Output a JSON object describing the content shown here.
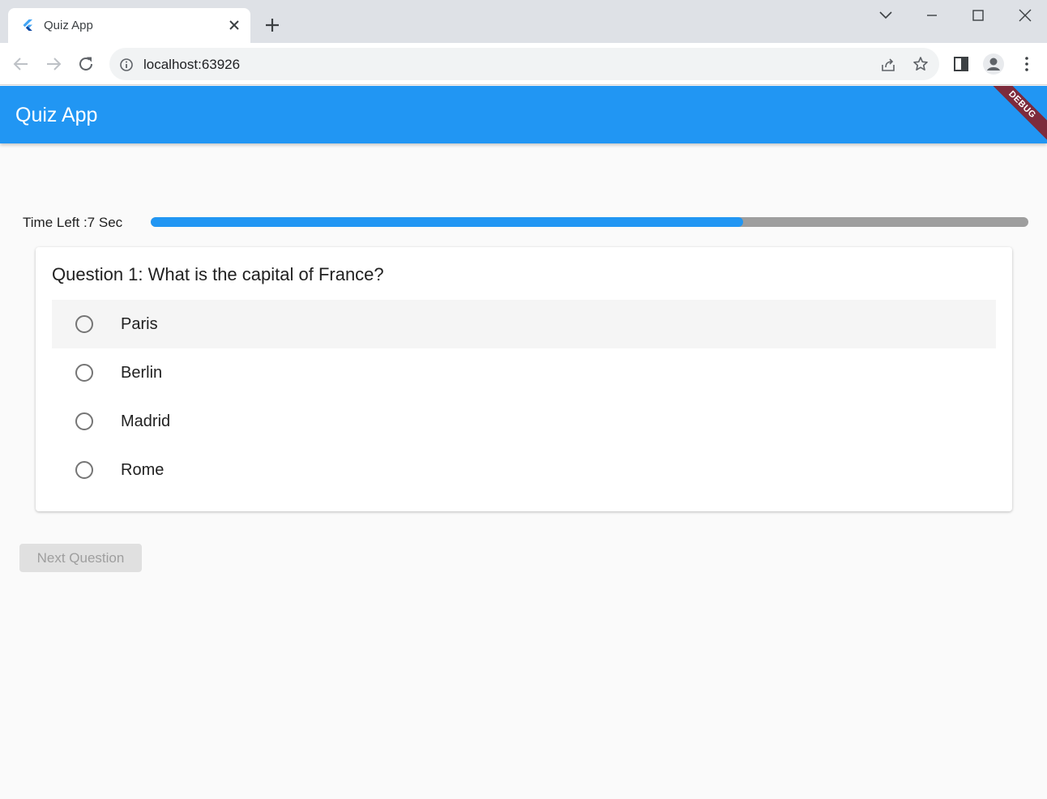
{
  "browser": {
    "tab_title": "Quiz App",
    "url": "localhost:63926"
  },
  "app": {
    "title": "Quiz App",
    "debug_label": "DEBUG",
    "accent_color": "#2196f3"
  },
  "timer": {
    "label": "Time Left :7 Sec",
    "progress": 0.675
  },
  "question": {
    "text": "Question 1: What is the capital of France?",
    "options": [
      {
        "label": "Paris"
      },
      {
        "label": "Berlin"
      },
      {
        "label": "Madrid"
      },
      {
        "label": "Rome"
      }
    ]
  },
  "next_button": {
    "label": "Next Question",
    "enabled": false
  }
}
